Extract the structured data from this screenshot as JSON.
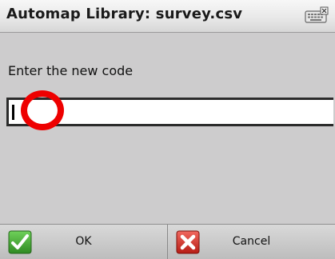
{
  "window": {
    "title": "Automap Library: survey.csv",
    "keyboard_icon": "keyboard-icon"
  },
  "dialog": {
    "prompt": "Enter the new code",
    "input_value": ""
  },
  "buttons": {
    "ok_label": "OK",
    "ok_icon": "checkmark-icon",
    "cancel_label": "Cancel",
    "cancel_icon": "close-x-icon"
  },
  "colors": {
    "background": "#cdcccd",
    "highlight": "#ee0000",
    "ok_green": "#3aa52a",
    "cancel_red": "#d92b22"
  }
}
